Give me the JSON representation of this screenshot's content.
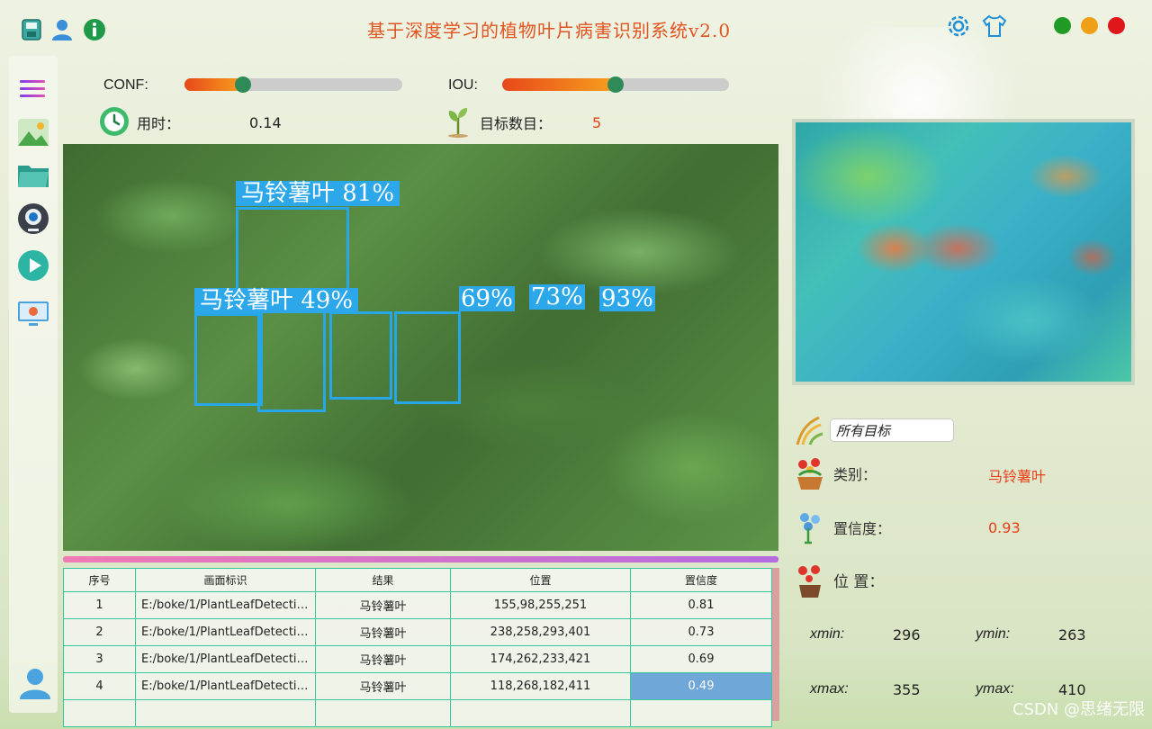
{
  "app": {
    "title": "基于深度学习的植物叶片病害识别系统v2.0",
    "window_controls": {
      "close_color": "#e0161c",
      "minimize_color": "#f0a016",
      "maximize_color": "#1f9a24"
    }
  },
  "toolbar": {
    "left_icons": [
      "save-icon",
      "user-icon",
      "info-icon"
    ],
    "right_icons": [
      "settings-icon",
      "skin-icon"
    ]
  },
  "sidebar": {
    "items": [
      "menu-icon",
      "image-icon",
      "folder-icon",
      "camera-icon",
      "play-icon",
      "model-icon"
    ],
    "bottom": "user-avatar-icon"
  },
  "params": {
    "conf_label": "CONF:",
    "conf_value": 0.27,
    "iou_label": "IOU:",
    "iou_value": 0.5,
    "time_label": "用时：",
    "time_value": "0.14",
    "count_label": "目标数目：",
    "count_value": "5"
  },
  "detections": [
    {
      "label": "马铃薯叶  81%"
    },
    {
      "label": "马铃薯叶  49%"
    },
    {
      "label": "69%"
    },
    {
      "label": "73%"
    },
    {
      "label": "93%"
    }
  ],
  "table": {
    "headers": [
      "序号",
      "画面标识",
      "结果",
      "位置",
      "置信度"
    ],
    "rows": [
      [
        "1",
        "E:/boke/1/PlantLeafDetectio...",
        "马铃薯叶",
        "155,98,255,251",
        "0.81"
      ],
      [
        "2",
        "E:/boke/1/PlantLeafDetectio...",
        "马铃薯叶",
        "238,258,293,401",
        "0.73"
      ],
      [
        "3",
        "E:/boke/1/PlantLeafDetectio...",
        "马铃薯叶",
        "174,262,233,421",
        "0.69"
      ],
      [
        "4",
        "E:/boke/1/PlantLeafDetectio...",
        "马铃薯叶",
        "118,268,182,411",
        "0.49"
      ],
      [
        "",
        "",
        "",
        "",
        ""
      ]
    ]
  },
  "result": {
    "target_select": "所有目标",
    "class_label": "类别：",
    "class_value": "马铃薯叶",
    "conf_label": "置信度：",
    "conf_value": "0.93",
    "pos_label": "位  置：",
    "xmin_label": "xmin:",
    "xmin": "296",
    "ymin_label": "ymin:",
    "ymin": "263",
    "xmax_label": "xmax:",
    "xmax": "355",
    "ymax_label": "ymax:",
    "ymax": "410"
  },
  "watermark": "CSDN @思绪无限",
  "colors": {
    "accent": "#e2541f",
    "value": "#e8401a",
    "box": "#27a6e8",
    "table_border": "#38c79d"
  }
}
